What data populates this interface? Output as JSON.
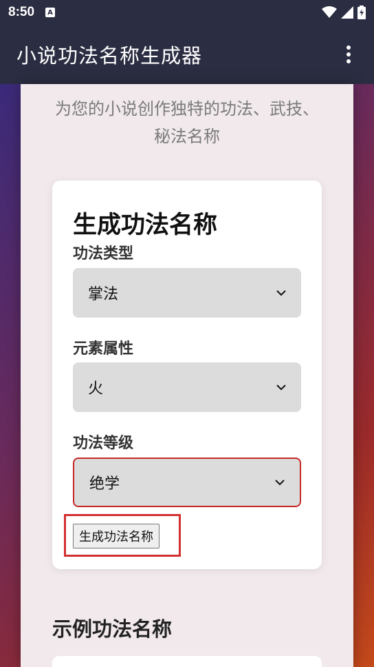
{
  "status_bar": {
    "time": "8:50",
    "notification_icon": "A"
  },
  "app_bar": {
    "title": "小说功法名称生成器"
  },
  "page": {
    "subtitle": "为您的小说创作独特的功法、武技、秘法名称"
  },
  "generator": {
    "title": "生成功法名称",
    "fields": [
      {
        "label": "功法类型",
        "selected": "掌法"
      },
      {
        "label": "元素属性",
        "selected": "火"
      },
      {
        "label": "功法等级",
        "selected": "绝学"
      }
    ],
    "button_label": "生成功法名称"
  },
  "examples": {
    "title": "示例功法名称"
  },
  "colors": {
    "app_bar": "#2b2d42",
    "panel": "#f1e9eb",
    "select_bg": "#dcdcdc",
    "highlight": "#d32f2f"
  }
}
